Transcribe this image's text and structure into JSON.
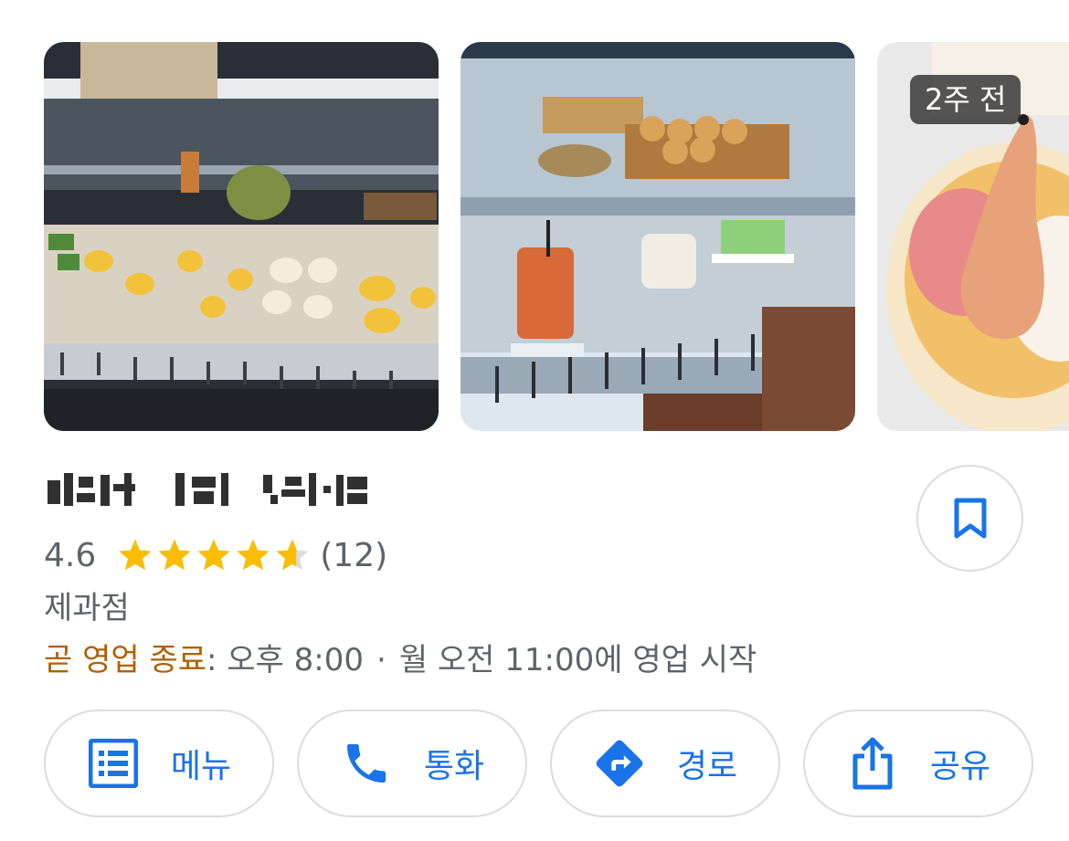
{
  "photos": {
    "items": [
      {
        "icon": "bakery-display-case-photo"
      },
      {
        "icon": "drinks-and-cakes-case-photo"
      },
      {
        "icon": "shrimp-dessert-photo",
        "age_badge": "2주 전"
      }
    ]
  },
  "place": {
    "name_blurred": true,
    "rating": "4.6",
    "rating_value": 4.6,
    "review_count": "(12)",
    "category": "제과점",
    "hours_status": "곧 영업 종료",
    "hours_close": ": 오후 8:00",
    "hours_separator": "·",
    "hours_next": "월 오전 11:00에 영업 시작"
  },
  "actions": {
    "menu_label": "메뉴",
    "call_label": "통화",
    "route_label": "경로",
    "share_label": "공유"
  },
  "colors": {
    "accent": "#1a73e8",
    "star": "#fbbc04",
    "status_warning": "#b06000",
    "secondary_text": "#5f6368",
    "button_border": "#dadce0"
  }
}
